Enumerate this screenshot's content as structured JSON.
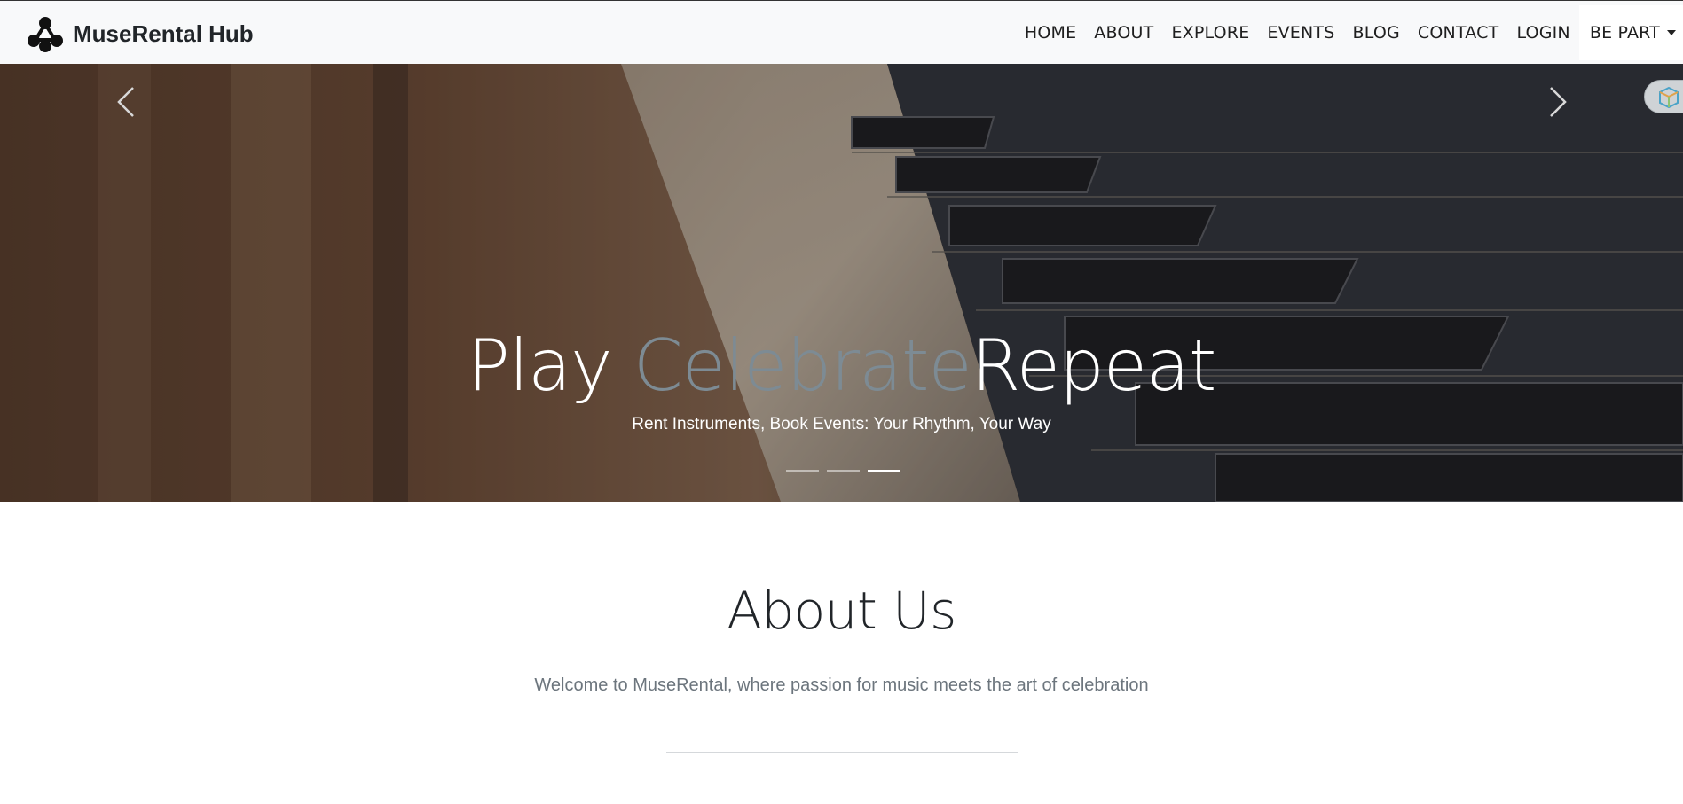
{
  "brand": {
    "name": "MuseRental Hub",
    "logo_icon": "molecule-icon"
  },
  "nav": {
    "items": [
      {
        "label": "HOME"
      },
      {
        "label": "ABOUT"
      },
      {
        "label": "EXPLORE"
      },
      {
        "label": "EVENTS"
      },
      {
        "label": "BLOG"
      },
      {
        "label": "CONTACT"
      },
      {
        "label": "LOGIN"
      }
    ],
    "dropdown_label": "BE PART"
  },
  "hero": {
    "title_part1": "Play ",
    "title_part2": "Celebrate",
    "title_part3": "Repeat",
    "subtitle": "Rent Instruments, Book Events: Your Rhythm, Your Way",
    "prev_icon": "chevron-left-icon",
    "next_icon": "chevron-right-icon",
    "slide_count": 3,
    "active_slide": 3
  },
  "about": {
    "title": "About Us",
    "lead": "Welcome to MuseRental, where passion for music meets the art of celebration"
  },
  "colors": {
    "navbar_bg": "#f8f9fa",
    "text_dark": "#212529",
    "text_muted": "#6c757d",
    "hero_title_muted": "#7d8b94"
  }
}
